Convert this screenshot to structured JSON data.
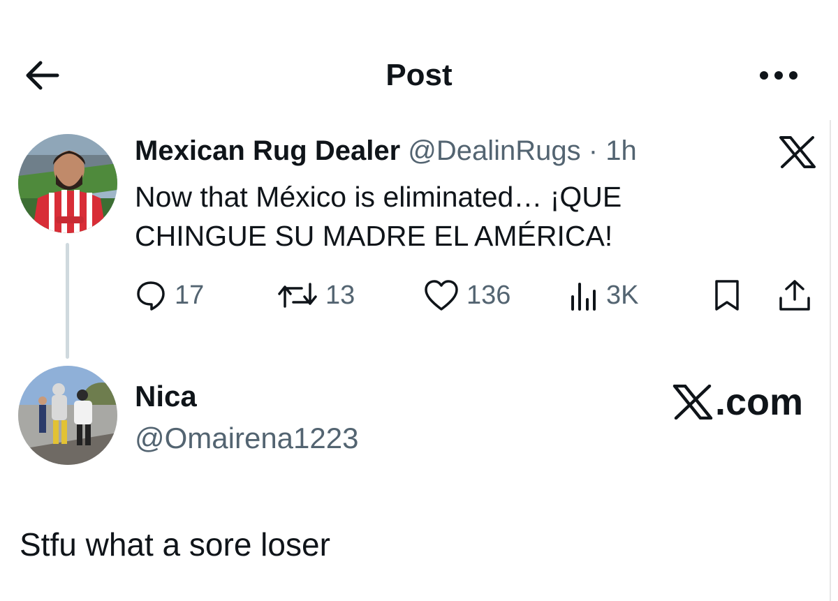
{
  "header": {
    "title": "Post",
    "back_icon": "arrow-left-icon",
    "more_icon": "more-horizontal-icon"
  },
  "tweet": {
    "author_name": "Mexican Rug Dealer",
    "handle": "@DealinRugs",
    "time": "· 1h",
    "text": "Now that México is eliminated… ¡QUE CHINGUE SU MADRE EL AMÉRICA!",
    "replies": "17",
    "retweets": "13",
    "likes": "136",
    "views": "3K"
  },
  "reply": {
    "author_name": "Nica",
    "handle": "@Omairena1223",
    "source": ".com",
    "text": "Stfu what a sore loser"
  },
  "colors": {
    "text": "#0f1419",
    "secondary": "#536471",
    "thread_line": "#cfd9de",
    "background": "#ffffff"
  }
}
